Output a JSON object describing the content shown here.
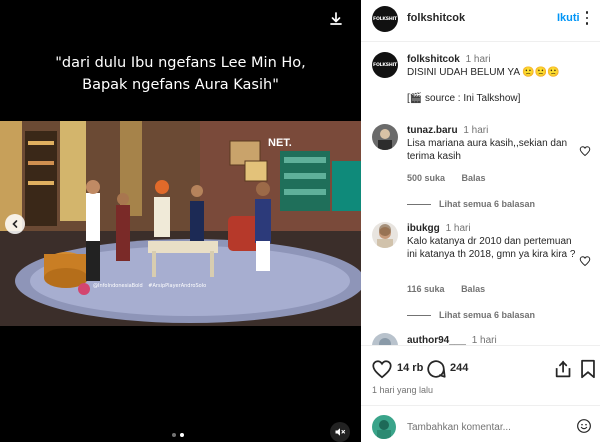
{
  "media": {
    "caption_line1": "\"dari dulu Ibu ngefans Lee Min Ho,",
    "caption_line2": "Bapak ngefans Aura Kasih\"",
    "tv_logo": "NET.",
    "watermark_handle": "@InfoIndonesiaBold",
    "watermark_tag": "#ArsipPlayerAndroSolo",
    "carousel_dots": 2,
    "carousel_active": 1
  },
  "header": {
    "logo_text": "FOLKSHIT",
    "username": "folkshitcok",
    "follow_label": "Ikuti"
  },
  "post": {
    "username": "folkshitcok",
    "time": "1 hari",
    "caption": "DISINI UDAH BELUM YA 🙁🙁🙁",
    "source": "[🎬 source : Ini Talkshow]"
  },
  "comments": [
    {
      "username": "tunaz.baru",
      "time": "1 hari",
      "text": "Lisa mariana aura kasih,,sekian dan terima kasih",
      "likes": "500 suka",
      "reply_label": "Balas",
      "view_replies": "Lihat semua 6 balasan"
    },
    {
      "username": "ibukgg",
      "time": "1 hari",
      "text": "Kalo katanya dr 2010 dan pertemuan ini katanya th 2018, gmn ya kira kira ?",
      "likes": "116 suka",
      "reply_label": "Balas",
      "view_replies": "Lihat semua 6 balasan"
    },
    {
      "username": "author94___",
      "time": "1 hari"
    }
  ],
  "actions": {
    "like_count": "14 rb",
    "comment_count": "244",
    "post_time": "1 hari yang lalu"
  },
  "composer": {
    "placeholder": "Tambahkan komentar..."
  },
  "icons": {
    "download": "download-icon",
    "prev": "chevron-left-icon",
    "mute": "speaker-muted-icon",
    "like": "heart-icon",
    "comment": "speech-bubble-icon",
    "share": "share-icon",
    "save": "bookmark-icon",
    "emoji": "smiley-icon",
    "more": "more-vertical-icon"
  }
}
